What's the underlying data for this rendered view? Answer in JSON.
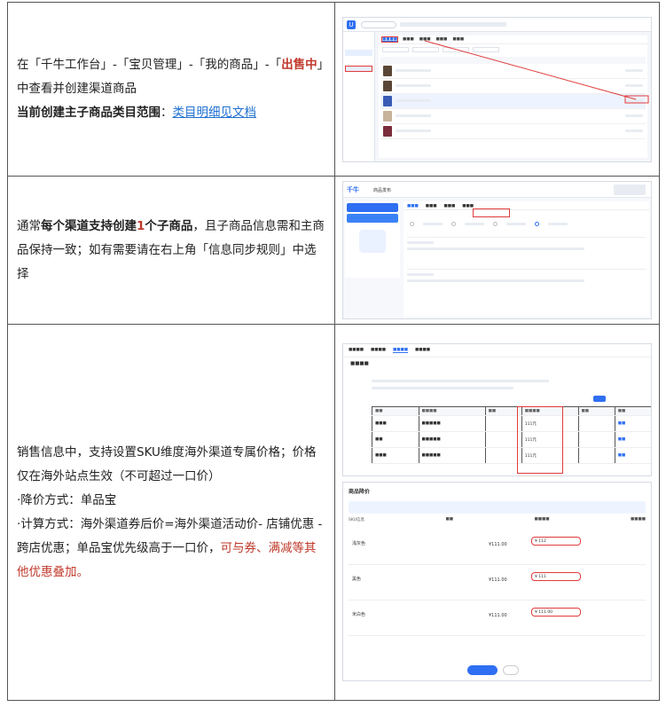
{
  "rows": [
    {
      "text": {
        "p1_a": "在「千牛工作台」-「宝贝管理」-「我的商品」-「",
        "p1_red": "出售中",
        "p1_b": "」中查看并创建渠道商品",
        "p2_bold": "当前创建主子商品类目范围",
        "p2_colon": "：",
        "p2_link": "类目明细见文档"
      }
    },
    {
      "text": {
        "a": "通常",
        "b_bold": "每个渠道支持创建",
        "c_red": "1",
        "d_bold": "个子商品",
        "e": "，且子商品信息需和主商品保持一致；如有需要请在右上角「信息同步规则」中选择"
      }
    },
    {
      "text": {
        "l1": "销售信息中，支持设置SKU维度海外渠道专属价格；价格仅在海外站点生效（不可超过一口价）",
        "l2": "·降价方式：单品宝",
        "l3": "·计算方式：海外渠道券后价=海外渠道活动价- 店铺优惠 - 跨店优惠；单品宝优先级高于一口价，",
        "l3_orange": "可与券、满减等其他优惠叠加。"
      }
    }
  ],
  "shot2": {
    "brand": "千牛",
    "page": "商品发布"
  },
  "shot3b": {
    "title": "商品降价",
    "rows": [
      {
        "name": "浅灰色",
        "price": "¥111.00",
        "input": "¥ 112"
      },
      {
        "name": "黑色",
        "price": "¥111.00",
        "input": "¥ 111"
      },
      {
        "name": "米白色",
        "price": "¥111.00",
        "input": "¥ 111.00"
      }
    ]
  }
}
